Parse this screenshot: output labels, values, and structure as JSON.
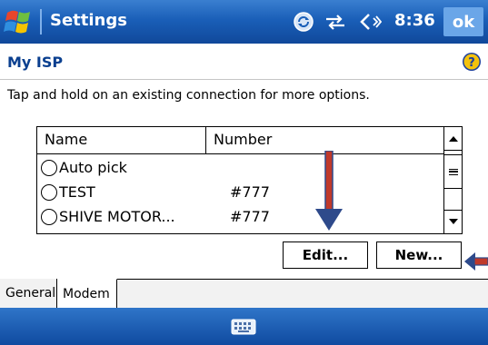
{
  "titlebar": {
    "title": "Settings",
    "clock": "8:36",
    "ok_label": "ok",
    "icons": [
      "windows-start-icon",
      "sync-icon",
      "connectivity-icon",
      "volume-icon"
    ]
  },
  "header": {
    "title": "My ISP",
    "help_icon": "help-icon"
  },
  "instruction": "Tap and hold on an existing connection for more options.",
  "listview": {
    "columns": [
      "Name",
      "Number"
    ],
    "rows": [
      {
        "name": "Auto pick",
        "number": ""
      },
      {
        "name": "TEST",
        "number": "#777"
      },
      {
        "name": "SHIVE MOTOR...",
        "number": "#777"
      }
    ]
  },
  "buttons": {
    "edit": "Edit...",
    "new": "New..."
  },
  "tabs": [
    {
      "label": "General",
      "active": false
    },
    {
      "label": "Modem",
      "active": true
    }
  ],
  "bottombar": {
    "icon": "keyboard-icon"
  },
  "colors": {
    "titlebar": "#1a5fb8",
    "annotation_arrow": "#c0392b",
    "annotation_arrow_outline": "#2e4a8b"
  }
}
